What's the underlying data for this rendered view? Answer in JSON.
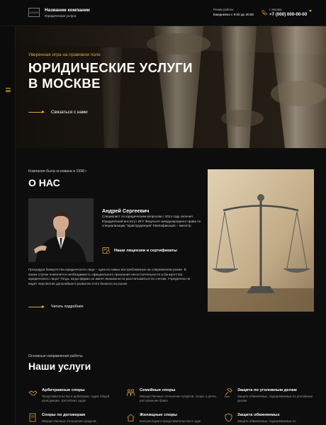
{
  "header": {
    "logo": "LOGO",
    "company_name": "Название компании",
    "company_sub": "Юридические услуги",
    "hours_label": "Режим работы:",
    "hours_value": "Ежедневно с 9:00 до 20:00",
    "city_label": "г. Москва",
    "phone": "+7 (000) 000-00-00",
    "accent": "#e0a63a"
  },
  "hero": {
    "tagline": "Уверенная игра на правовом поле",
    "title": "Юридические услуги в Москве",
    "cta": "Связаться с нами"
  },
  "about": {
    "subtitle": "Компания была основана в 1998 г",
    "title": "О НАС",
    "person_name": "Андрей Сергеевич",
    "person_bio": "Специалист по юридическим вопросам с 2014 году окончил Юридический институт ИГУ Факультет международного права по специализации \"юриспруденция\" Квалификация – магистр",
    "license_link": "Наши лицензии и сертификаты",
    "text": "Процедура банкротства юридического лица – одна из самых востребованных на современном рынке. В каком случае появляется необходимость официального признания несостоятельности и банкротства юридического лица? Тогда, когда фирма не имеет возможности рассчитываться по счетам. Учредители не видят перспектив дальнейшего развития этого бизнеса на рынке.",
    "more_link": "Читать подробнее"
  },
  "services": {
    "subtitle": "Основные направления работы",
    "title": "Наши услуги",
    "items": [
      {
        "icon": "handshake-icon",
        "title": "Арбитражные споры",
        "desc": "Представительство в арбитраже, судах общей юрисдикции, третейских судах"
      },
      {
        "icon": "family-icon",
        "title": "Семейные споры",
        "desc": "Имущественные отношения супругов, споры о детях, расторжение брака"
      },
      {
        "icon": "gavel-icon",
        "title": "Защита по уголовным делам",
        "desc": "Защита обвиняемых, подозреваемых по уголовным делам"
      },
      {
        "icon": "contract-icon",
        "title": "Споры по договорам",
        "desc": "Имущественные отношения супругов,"
      },
      {
        "icon": "house-icon",
        "title": "Жилищные споры",
        "desc": "Консультации и представительство в суде"
      },
      {
        "icon": "shield-icon",
        "title": "Защита обвиняемых",
        "desc": "Защита обвиняемых, подозреваемых по"
      }
    ]
  }
}
